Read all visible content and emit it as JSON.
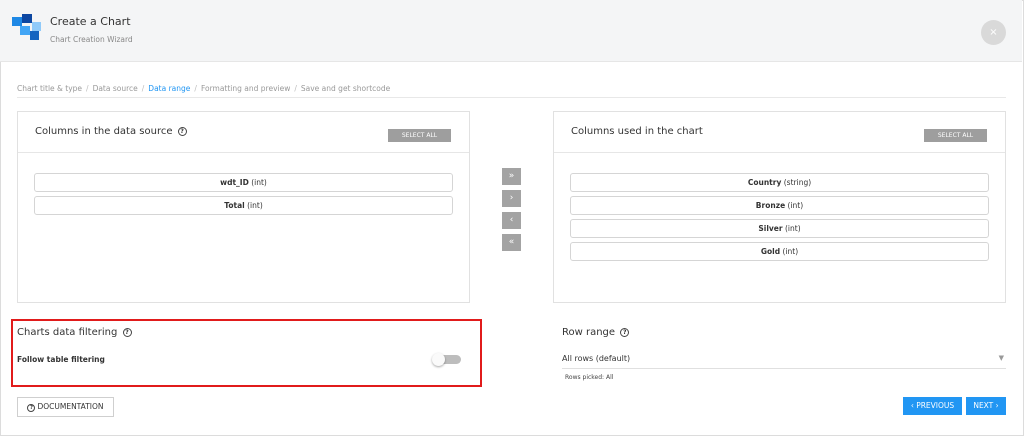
{
  "header": {
    "title": "Create a Chart",
    "subtitle": "Chart Creation Wizard",
    "close_label": "×"
  },
  "breadcrumb": [
    {
      "label": "Chart title & type",
      "active": false
    },
    {
      "label": "Data source",
      "active": false
    },
    {
      "label": "Data range",
      "active": true
    },
    {
      "label": "Formatting and preview",
      "active": false
    },
    {
      "label": "Save and get shortcode",
      "active": false
    }
  ],
  "breadcrumb_separator": "/",
  "source_panel": {
    "title": "Columns in the data source",
    "select_all_label": "SELECT ALL",
    "columns": [
      {
        "name": "wdt_ID",
        "type": "(int)"
      },
      {
        "name": "Total",
        "type": "(int)"
      }
    ]
  },
  "chart_panel": {
    "title": "Columns used in the chart",
    "select_all_label": "SELECT ALL",
    "columns": [
      {
        "name": "Country",
        "type": "(string)"
      },
      {
        "name": "Bronze",
        "type": "(int)"
      },
      {
        "name": "Silver",
        "type": "(int)"
      },
      {
        "name": "Gold",
        "type": "(int)"
      }
    ]
  },
  "transfer_buttons": {
    "add_all": "»",
    "add": "›",
    "remove": "‹",
    "remove_all": "«"
  },
  "filtering": {
    "title": "Charts data filtering",
    "follow_label": "Follow table filtering",
    "follow_enabled": false
  },
  "row_range": {
    "title": "Row range",
    "selected": "All rows (default)",
    "rows_picked": "Rows picked: All"
  },
  "footer": {
    "documentation_label": "DOCUMENTATION",
    "previous_label": "‹ PREVIOUS",
    "next_label": "NEXT ›"
  },
  "colors": {
    "accent": "#2196f3",
    "highlight": "#e11b1b",
    "button_gray": "#9e9e9e"
  },
  "icons": {
    "logo": "wizard-logo-icon",
    "help": "question-circle-icon",
    "close": "close-icon",
    "caret": "caret-down-icon"
  }
}
